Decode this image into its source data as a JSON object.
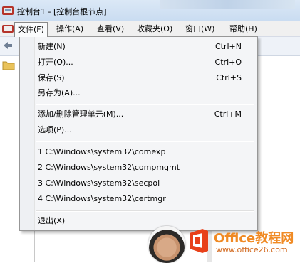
{
  "window": {
    "title": "控制台1 - [控制台根节点]"
  },
  "menubar": {
    "items": [
      {
        "label": "文件(F)",
        "active": true
      },
      {
        "label": "操作(A)"
      },
      {
        "label": "查看(V)"
      },
      {
        "label": "收藏夹(O)"
      },
      {
        "label": "窗口(W)"
      },
      {
        "label": "帮助(H)"
      }
    ]
  },
  "file_menu": {
    "new": {
      "label": "新建(N)",
      "shortcut": "Ctrl+N"
    },
    "open": {
      "label": "打开(O)...",
      "shortcut": "Ctrl+O"
    },
    "save": {
      "label": "保存(S)",
      "shortcut": "Ctrl+S"
    },
    "save_as": {
      "label": "另存为(A)..."
    },
    "add_remove_snapin": {
      "label": "添加/删除管理单元(M)...",
      "shortcut": "Ctrl+M"
    },
    "options": {
      "label": "选项(P)..."
    },
    "recent": [
      {
        "label": "1 C:\\Windows\\system32\\comexp"
      },
      {
        "label": "2 C:\\Windows\\system32\\compmgmt"
      },
      {
        "label": "3 C:\\Windows\\system32\\secpol"
      },
      {
        "label": "4 C:\\Windows\\system32\\certmgr"
      }
    ],
    "exit": {
      "label": "退出(X)"
    }
  },
  "watermark": {
    "title": "Office教程网",
    "url": "www.office26.com"
  },
  "colors": {
    "menu_bg": "#f4f5f7",
    "menubar_bg": "#f0f0f0",
    "titlebar_bg": "#dbe8f6",
    "watermark": "#f08a24"
  },
  "icons": [
    "mmc-app-icon",
    "document-icon",
    "back-arrow-icon",
    "folder-icon",
    "office-logo-icon"
  ]
}
